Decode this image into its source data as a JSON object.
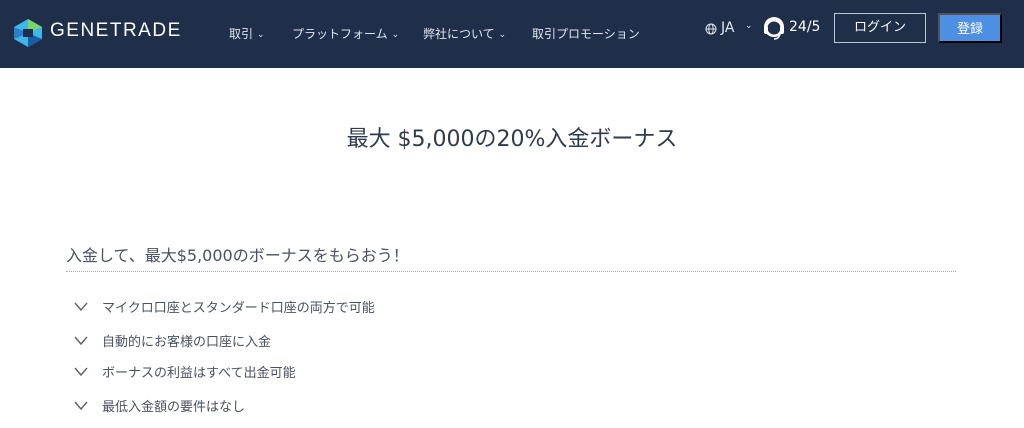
{
  "header": {
    "brand": "GENETRADE",
    "nav": [
      {
        "label": "取引",
        "has_dropdown": true
      },
      {
        "label": "プラットフォーム",
        "has_dropdown": true
      },
      {
        "label": "弊社について",
        "has_dropdown": true
      },
      {
        "label": "取引プロモーション",
        "has_dropdown": false
      }
    ],
    "language": {
      "label": "JA",
      "icon": "globe-icon"
    },
    "support": {
      "label": "24/5",
      "icon": "headset-icon"
    },
    "login_label": "ログイン",
    "register_label": "登録",
    "colors": {
      "background": "#1f2f4a",
      "accent": "#4d8fe3"
    }
  },
  "promo": {
    "headline": "最大 $5,000の20%入金ボーナス",
    "subhead": "入金して、最大$5,000のボーナスをもらおう！",
    "features": [
      "マイクロ口座とスタンダード口座の両方で可能",
      "自動的にお客様の口座に入金",
      "ボーナスの利益はすべて出金可能",
      "最低入金額の要件はなし"
    ]
  }
}
